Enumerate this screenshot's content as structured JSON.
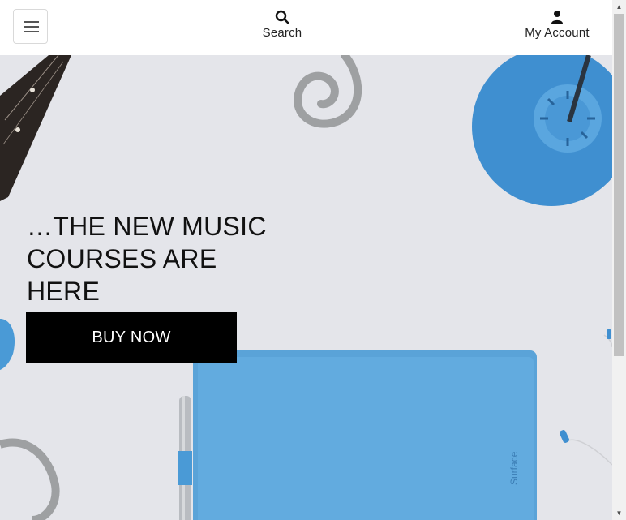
{
  "header": {
    "menu_icon": "hamburger-icon",
    "search": {
      "label": "Search",
      "icon": "search-icon"
    },
    "account": {
      "label": "My Account",
      "icon": "user-icon"
    }
  },
  "hero": {
    "title_line1": "…THE NEW MUSIC",
    "title_line2": "COURSES ARE HERE",
    "cta_label": "BUY NOW",
    "tablet_brand": "Surface"
  },
  "colors": {
    "hero_bg": "#e4e5ea",
    "accent_blue": "#4f9fd8",
    "button_bg": "#000000",
    "button_text": "#ffffff"
  }
}
